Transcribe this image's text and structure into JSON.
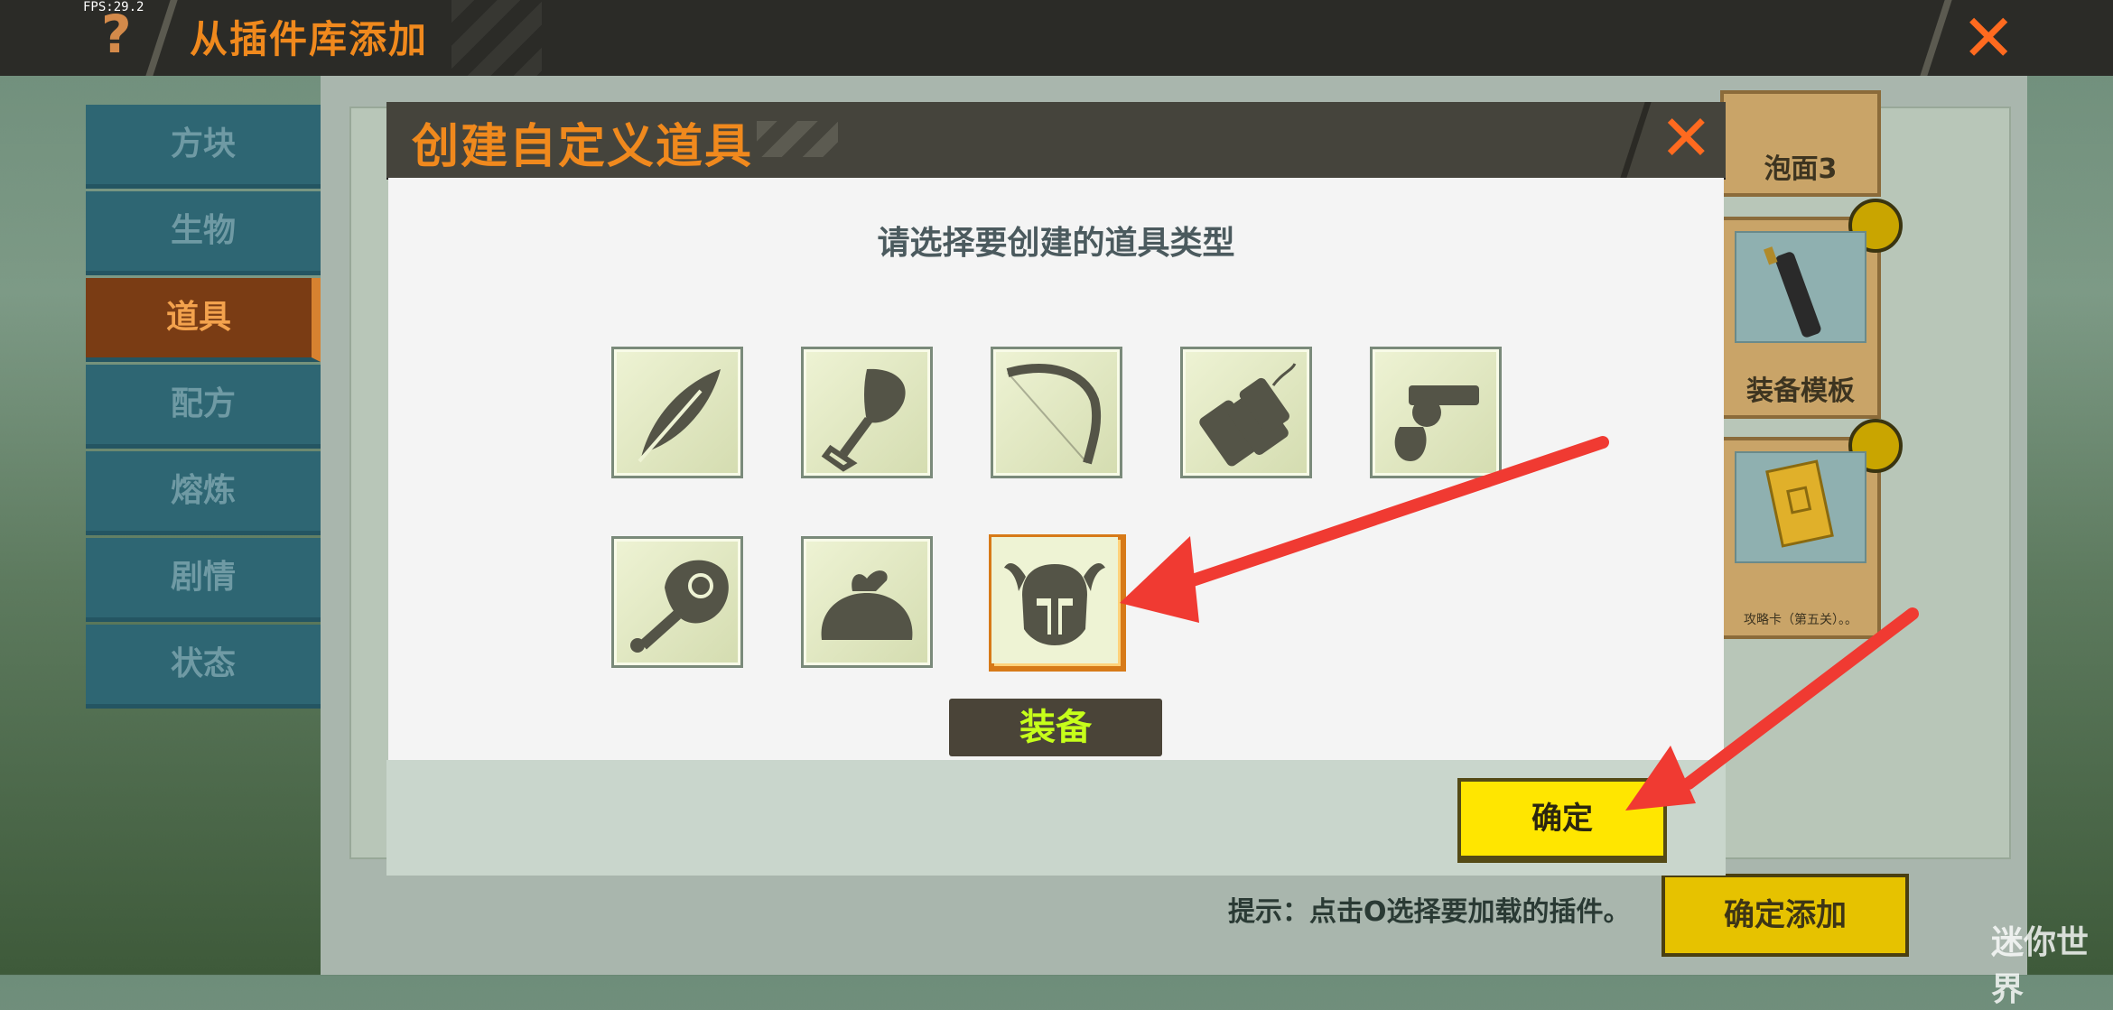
{
  "fps": "FPS:29.2",
  "topbar": {
    "help_glyph": "?",
    "title": "从插件库添加",
    "close_glyph": "✕"
  },
  "sidebar": {
    "items": [
      {
        "label": "方块"
      },
      {
        "label": "生物"
      },
      {
        "label": "道具",
        "active": true
      },
      {
        "label": "配方"
      },
      {
        "label": "熔炼"
      },
      {
        "label": "剧情"
      },
      {
        "label": "状态"
      }
    ]
  },
  "cards": [
    {
      "label": "泡面3"
    },
    {
      "label": "装备模板"
    },
    {
      "label": "攻略卡（第五关）。。"
    }
  ],
  "footer": {
    "hint": "提示：点击O选择要加载的插件。",
    "confirm_add": "确定添加"
  },
  "modal": {
    "title": "创建自定义道具",
    "close_glyph": "✕",
    "prompt": "请选择要创建的道具类型",
    "items": [
      {
        "icon": "feather-icon"
      },
      {
        "icon": "shovel-icon"
      },
      {
        "icon": "bow-icon"
      },
      {
        "icon": "dynamite-icon"
      },
      {
        "icon": "revolver-icon"
      },
      {
        "icon": "meat-icon"
      },
      {
        "icon": "sack-icon"
      },
      {
        "icon": "helmet-icon",
        "selected": true
      }
    ],
    "selected_type_label": "装备",
    "ok_button": "确定"
  },
  "watermark": "迷你世界",
  "colors": {
    "accent_orange": "#f0891d",
    "confirm_yellow": "#ffe600",
    "tab_teal": "#2e6673",
    "arrow_red": "#f03a32"
  }
}
